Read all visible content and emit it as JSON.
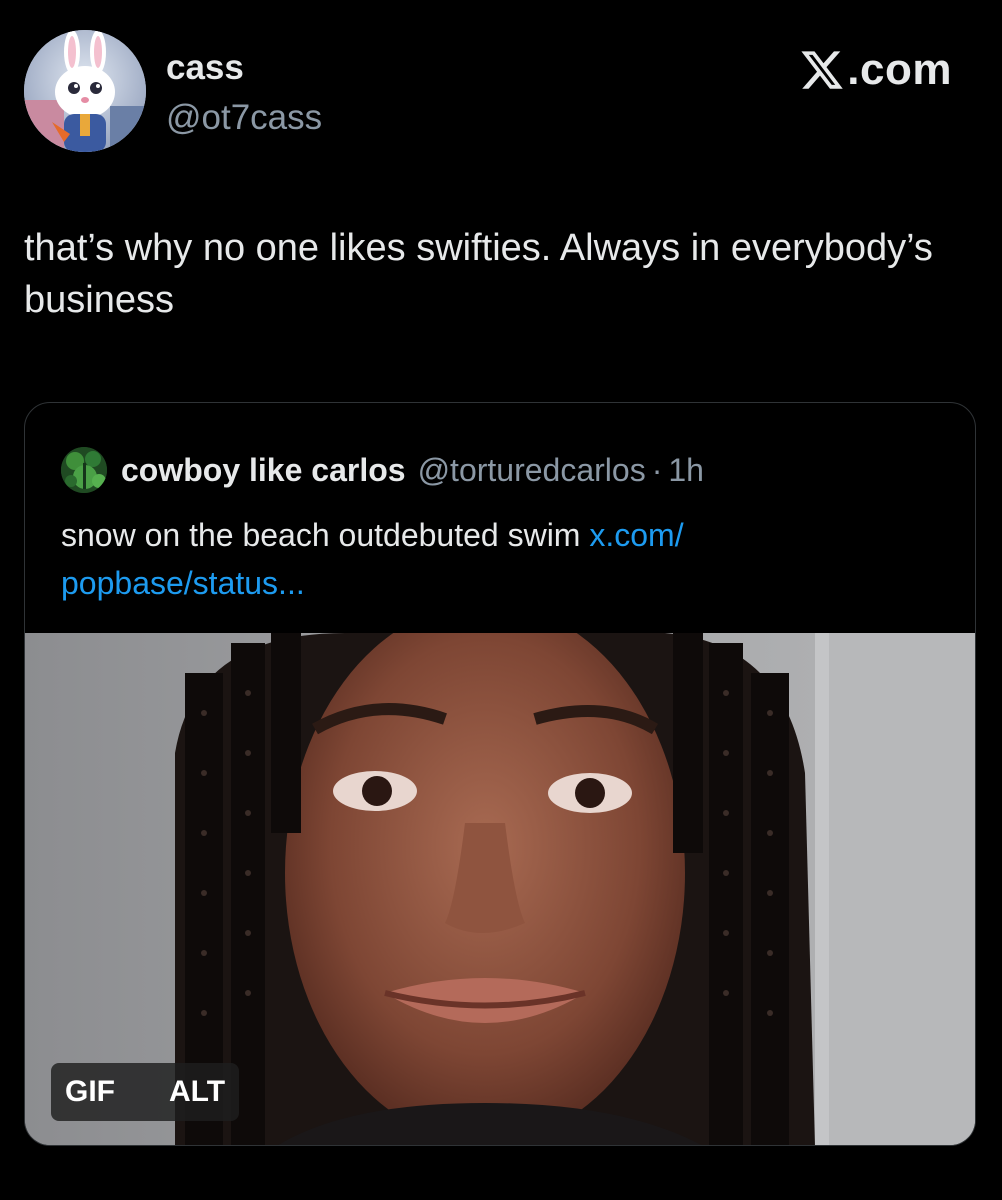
{
  "post": {
    "author": {
      "display_name": "cass",
      "handle": "@ot7cass",
      "avatar_icon": "bunny-avatar"
    },
    "brand": {
      "text": ".com",
      "icon": "x-logo-icon"
    },
    "text": "that’s why no one likes swifties. Always in everybody’s business"
  },
  "quote": {
    "author": {
      "display_name": "cowboy like carlos",
      "handle": "@torturedcarlos",
      "separator": "·",
      "time": "1h",
      "avatar_icon": "green-avatar"
    },
    "text": "snow on the beach outdebuted swim ",
    "link": "x.com/ popbase/status..."
  },
  "media": {
    "badges": [
      "GIF",
      "ALT"
    ]
  },
  "colors": {
    "background": "#000000",
    "text_primary": "#e7e9ea",
    "text_secondary": "#8b98a5",
    "link": "#1d9bf0",
    "border": "#2f3336"
  }
}
